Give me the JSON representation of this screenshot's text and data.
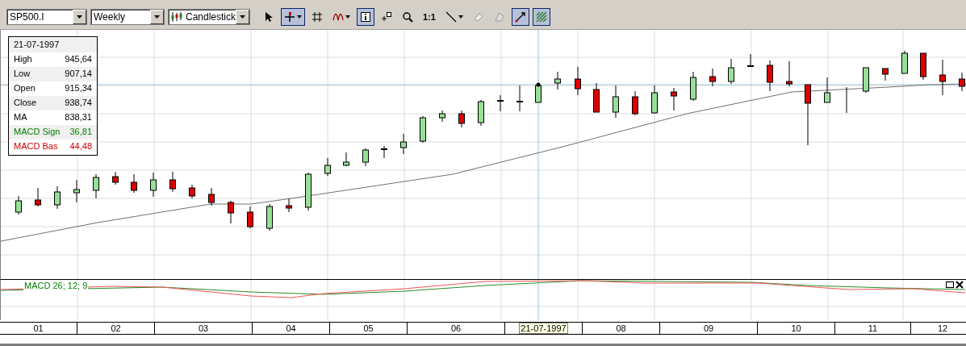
{
  "toolbar": {
    "symbol": "SP500.I",
    "period": "Weekly",
    "chart_type": "Candlestick",
    "tools": [
      {
        "kind": "pointer",
        "pressed": false
      },
      {
        "kind": "crosshair",
        "pressed": true
      },
      {
        "kind": "grid",
        "pressed": false
      },
      {
        "kind": "indicator",
        "pressed": false
      },
      {
        "kind": "info",
        "pressed": true
      },
      {
        "kind": "note",
        "pressed": false
      },
      {
        "kind": "zoom",
        "pressed": false
      },
      {
        "kind": "text",
        "label": "1:1",
        "pressed": false
      },
      {
        "kind": "line",
        "pressed": false
      },
      {
        "kind": "eraser",
        "pressed": false
      },
      {
        "kind": "shape",
        "pressed": false
      },
      {
        "kind": "trend",
        "pressed": true
      },
      {
        "kind": "hatch",
        "pressed": true
      }
    ]
  },
  "info_box": {
    "date": "21-07-1997",
    "rows": [
      {
        "label": "High",
        "value": "945,64",
        "kind": "price"
      },
      {
        "label": "Low",
        "value": "907,14",
        "kind": "price"
      },
      {
        "label": "Open",
        "value": "915,34",
        "kind": "price"
      },
      {
        "label": "Close",
        "value": "938,74",
        "kind": "price"
      },
      {
        "label": "MA",
        "value": "838,31",
        "kind": "price"
      },
      {
        "label": "MACD Sign",
        "value": "36,81",
        "kind": "signal"
      },
      {
        "label": "MACD Bas",
        "value": "44,48",
        "kind": "base"
      }
    ]
  },
  "macd_panel": {
    "label": "MACD 26; 12; 9"
  },
  "time_axis": [
    {
      "text": "01",
      "kind": "month"
    },
    {
      "text": "02",
      "kind": "month"
    },
    {
      "text": "03",
      "kind": "month"
    },
    {
      "text": "04",
      "kind": "month"
    },
    {
      "text": "05",
      "kind": "month"
    },
    {
      "text": "06",
      "kind": "month"
    },
    {
      "text": "21-07-1997",
      "kind": "cursor"
    },
    {
      "text": "08",
      "kind": "month"
    },
    {
      "text": "09",
      "kind": "month"
    },
    {
      "text": "10",
      "kind": "month"
    },
    {
      "text": "11",
      "kind": "month"
    },
    {
      "text": "12",
      "kind": "month"
    }
  ]
}
